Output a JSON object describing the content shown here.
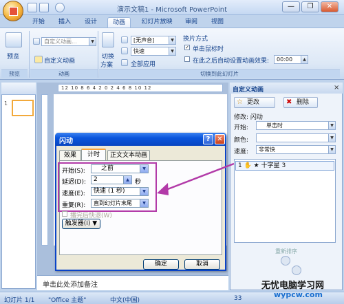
{
  "window": {
    "title": "演示文稿1 - Microsoft PowerPoint",
    "min_label": "—",
    "max_label": "❐",
    "close_label": "✕"
  },
  "tabs": [
    "开始",
    "插入",
    "设计",
    "动画",
    "幻灯片放映",
    "审阅",
    "视图"
  ],
  "active_tab": "动画",
  "ribbon": {
    "preview_label": "预览",
    "preview_group_label": "预览",
    "custom_animation_combo": "自定义动画...",
    "custom_animation_button": "自定义动画",
    "animation_group_label": "动画",
    "switch_scheme_label1": "切换",
    "switch_scheme_label2": "方案",
    "sound_combo": "[无声音]",
    "speed_combo": "快速",
    "apply_all_label": "全部应用",
    "switch_mode_title": "换片方式",
    "on_click_label": "单击鼠标时",
    "after_time_label": "在此之后自动设置动画效果:",
    "time_value": "00:00",
    "transition_group_label": "切换到此幻灯片"
  },
  "slides_pane": {
    "thumb_number": "1"
  },
  "ruler": {
    "marks": "12  10  8  6  4  2  0  2  4  6  8  10  12"
  },
  "notes_placeholder": "单击此处添加备注",
  "task_pane": {
    "title": "自定义动画",
    "close_label": "×",
    "change_button": "更改",
    "delete_button": "删除",
    "modify_label": "修改: 闪动",
    "start_label": "开始:",
    "start_value": "单击时",
    "color_label": "颜色:",
    "color_value": "",
    "speed_label": "速度:",
    "speed_value": "非常快",
    "list_item": "1 ✋ ★ 十字星 3",
    "reorder_label": "重新排序"
  },
  "dialog": {
    "title": "闪动",
    "help_label": "?",
    "close_label": "✕",
    "tabs": [
      "效果",
      "计时",
      "正文文本动画"
    ],
    "active_tab": "计时",
    "start_label": "开始(S):",
    "start_value": "之前",
    "delay_label": "延迟(D):",
    "delay_value": "2",
    "delay_unit": "秒",
    "speed_label": "速度(E):",
    "speed_value": "快速 (1 秒)",
    "repeat_label": "重复(R):",
    "repeat_value": "直到幻灯片末尾",
    "rewind_label": "播完后快退(W)",
    "trigger_button": "触发器(I) ▼",
    "ok_button": "确定",
    "cancel_button": "取消"
  },
  "status_bar": {
    "slide_info": "幻灯片 1/1",
    "theme": "\"Office 主题\"",
    "language": "中文(中国)",
    "zoom": "33"
  },
  "watermark": {
    "line1": "无忧电脑学习网",
    "line2": "wypcw.com"
  },
  "colors": {
    "highlight_box": "#b23aa8",
    "arrow": "#b23aa8",
    "dialog_title": "#0a55dc"
  }
}
